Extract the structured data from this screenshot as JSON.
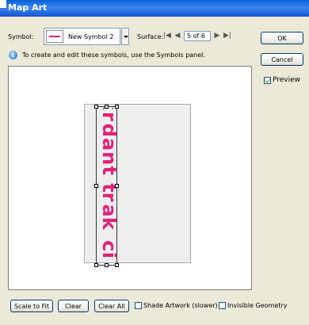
{
  "window": {
    "title": "Map Art"
  },
  "symbol": {
    "label": "Symbol:",
    "value": "New Symbol 2"
  },
  "surface": {
    "label": "Surface:",
    "value": "5 of 6",
    "nav": {
      "first": "|◀",
      "prev": "◀",
      "next": "▶",
      "last": "▶|"
    }
  },
  "info": {
    "text": "To create and edit these symbols, use the Symbols panel."
  },
  "buttons": {
    "ok": "OK",
    "cancel": "Cancel"
  },
  "preview": {
    "label": "Preview",
    "checked": true
  },
  "artwork": {
    "text": "ᴉɔ ʞɐɹʇ ʇuɐpɹʞ",
    "color": "#e0217a"
  },
  "bottom": {
    "scale_to_fit": "Scale to Fit",
    "clear": "Clear",
    "clear_all": "Clear All",
    "shade_artwork": "Shade Artwork (slower)",
    "invisible_geometry": "Invisible Geometry"
  },
  "colors": {
    "titlebar": "#0a5fd6",
    "dialog_bg": "#ece9d8",
    "accent": "#e0217a"
  }
}
